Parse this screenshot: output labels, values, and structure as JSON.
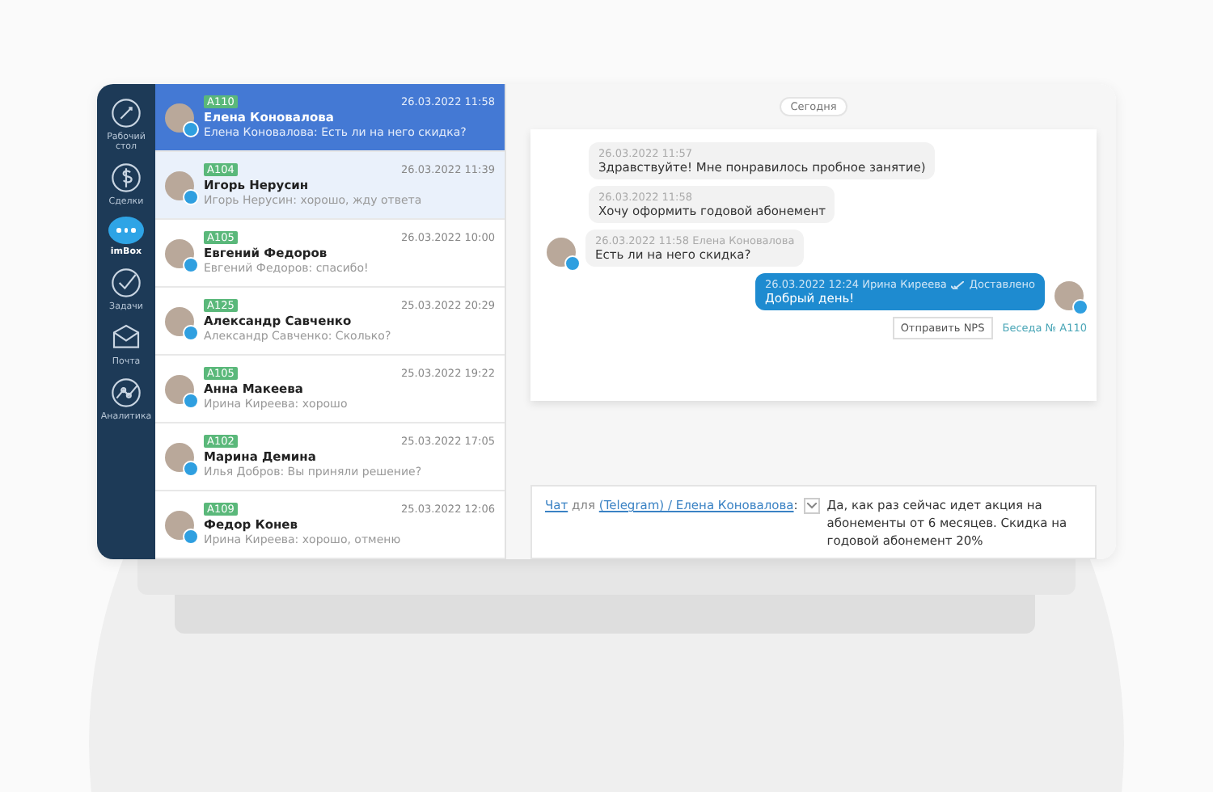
{
  "nav": [
    {
      "label": "Рабочий стол",
      "selected": false
    },
    {
      "label": "Сделки",
      "selected": false
    },
    {
      "label": "imBox",
      "selected": true
    },
    {
      "label": "Задачи",
      "selected": false
    },
    {
      "label": "Почта",
      "selected": false
    },
    {
      "label": "Аналитика",
      "selected": false
    }
  ],
  "conversations": [
    {
      "tag": "A110",
      "date": "26.03.2022 11:58",
      "name": "Елена Коновалова",
      "preview": "Елена Коновалова: Есть ли на него скидка?",
      "selected": true,
      "hovered": false
    },
    {
      "tag": "A104",
      "date": "26.03.2022 11:39",
      "name": "Игорь Нерусин",
      "preview": "Игорь Нерусин: хорошо, жду ответа",
      "selected": false,
      "hovered": true
    },
    {
      "tag": "A105",
      "date": "26.03.2022 10:00",
      "name": "Евгений Федоров",
      "preview": "Евгений Федоров: спасибо!",
      "selected": false,
      "hovered": false
    },
    {
      "tag": "A125",
      "date": "25.03.2022 20:29",
      "name": "Александр Савченко",
      "preview": "Александр Савченко: Сколько?",
      "selected": false,
      "hovered": false
    },
    {
      "tag": "A105",
      "date": "25.03.2022 19:22",
      "name": "Анна Макеева",
      "preview": "Ирина Киреева: хорошо",
      "selected": false,
      "hovered": false
    },
    {
      "tag": "A102",
      "date": "25.03.2022 17:05",
      "name": "Марина Демина",
      "preview": "Илья Добров: Вы приняли решение?",
      "selected": false,
      "hovered": false
    },
    {
      "tag": "A109",
      "date": "25.03.2022 12:06",
      "name": "Федор Конев",
      "preview": "Ирина Киреева: хорошо, отменю",
      "selected": false,
      "hovered": false
    }
  ],
  "chat": {
    "day": "Сегодня",
    "messages": [
      {
        "kind": "incoming",
        "meta": "26.03.2022 11:57",
        "text": "Здравствуйте! Мне понравилось пробное занятие)",
        "avatar": false
      },
      {
        "kind": "incoming",
        "meta": "26.03.2022 11:58",
        "text": "Хочу оформить годовой абонемент",
        "avatar": false
      },
      {
        "kind": "incoming",
        "meta": "26.03.2022 11:58 Елена Коновалова",
        "text": "Есть ли на него скидка?",
        "avatar": true
      },
      {
        "kind": "outgoing",
        "meta": "26.03.2022 12:24 Ирина Киреева",
        "status": "Доставлено",
        "text": "Добрый день!",
        "avatar": true
      }
    ],
    "nps_button": "Отправить NPS",
    "conversation_link": "Беседа № A110"
  },
  "composer": {
    "channel_link": "Чат",
    "for": "для",
    "recipient_link": "(Telegram) / Елена Коновалова",
    "separator": ":",
    "value": "Да, как раз сейчас идет акция на абонементы от 6 месяцев. Скидка на годовой абонемент 20%"
  }
}
